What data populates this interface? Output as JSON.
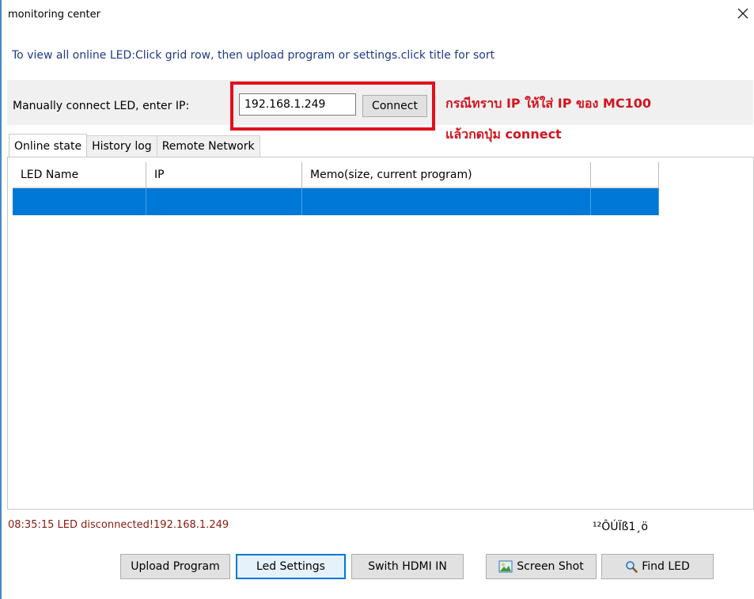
{
  "window": {
    "title": "monitoring center",
    "close_glyph": "✕"
  },
  "info_text": "To view all online LED:Click grid row, then upload program or settings.click title for sort",
  "connect": {
    "label": "Manually connect LED, enter IP:",
    "ip_value": "192.168.1.249",
    "button_label": "Connect"
  },
  "annotation": {
    "line1": "กรณีทราบ IP ให้ใส่ IP ของ MC100",
    "line2": "แล้วกดปุ่ม connect",
    "color": "#d4141e"
  },
  "tabs": [
    {
      "label": "Online state",
      "active": true
    },
    {
      "label": "History log",
      "active": false
    },
    {
      "label": "Remote Network",
      "active": false
    }
  ],
  "grid": {
    "columns": [
      "LED Name",
      "IP",
      "Memo(size, current program)",
      ""
    ],
    "rows": [
      {
        "led_name": "",
        "ip": "",
        "memo": "",
        "extra": "",
        "selected": true
      }
    ],
    "selection_color": "#0078d7"
  },
  "status": {
    "message": "08:35:15  LED disconnected!192.168.1.249",
    "right_text": "¹²ÔÚÏß1¸ö"
  },
  "buttons": {
    "upload_program": "Upload Program",
    "led_settings": "Led Settings",
    "switch_hdmi": "Swith HDMI IN",
    "screen_shot": "Screen Shot",
    "find_led": "Find LED"
  },
  "icons": {
    "close": "close-icon",
    "screen_shot": "picture-icon",
    "find_led": "magnifier-icon"
  }
}
